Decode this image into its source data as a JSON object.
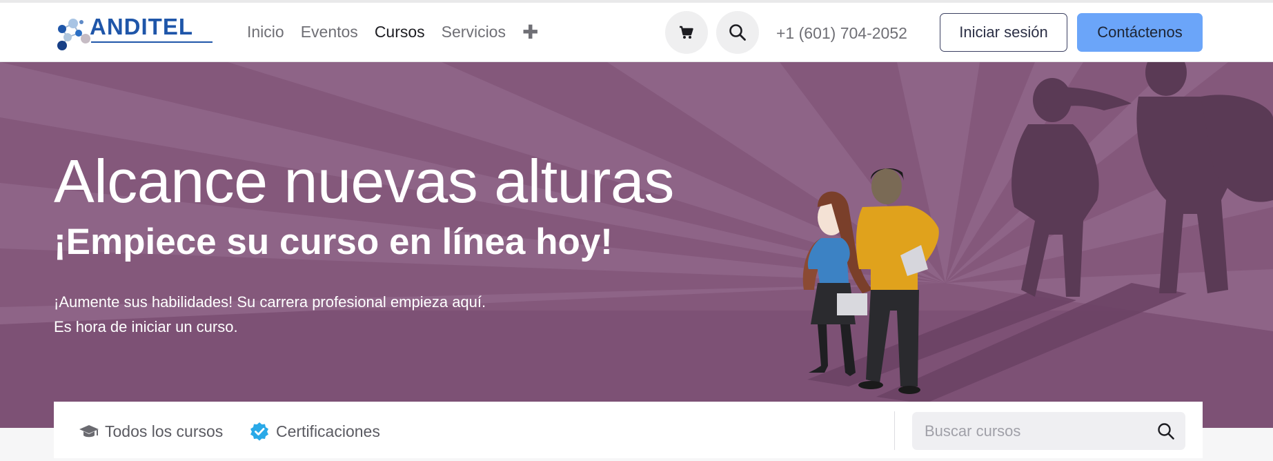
{
  "brand": {
    "name": "ANDITEL",
    "color": "#1f56a9"
  },
  "nav": {
    "links": [
      {
        "label": "Inicio",
        "active": false
      },
      {
        "label": "Eventos",
        "active": false
      },
      {
        "label": "Cursos",
        "active": true
      },
      {
        "label": "Servicios",
        "active": false
      }
    ],
    "more_icon": "plus-icon",
    "cart_icon": "cart-icon",
    "search_icon": "search-icon",
    "phone": "+1 (601) 704-2052",
    "login_label": "Iniciar sesión",
    "contact_label": "Contáctenos"
  },
  "hero": {
    "title": "Alcance nuevas alturas",
    "subtitle": "¡Empiece su curso en línea hoy!",
    "line1": "¡Aumente sus habilidades! Su carrera profesional empieza aquí.",
    "line2": "Es hora de iniciar un curso.",
    "background_color": "#84587b"
  },
  "course_bar": {
    "all_courses": "Todos los cursos",
    "certifications": "Certificaciones",
    "search_placeholder": "Buscar cursos"
  },
  "colors": {
    "accent": "#6ba5f9",
    "check_badge": "#2aa9e8"
  }
}
